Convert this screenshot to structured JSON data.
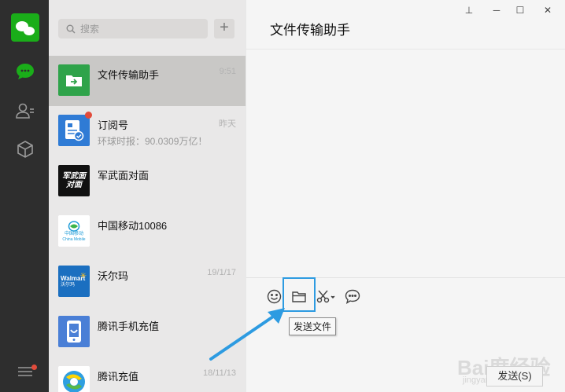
{
  "window": {
    "pin_icon": "pin-icon",
    "minimize_icon": "minimize-icon",
    "maximize_icon": "maximize-icon",
    "close_icon": "close-icon"
  },
  "sidebar": {
    "icons": [
      "chat-icon",
      "contacts-icon",
      "favorites-icon",
      "menu-icon"
    ]
  },
  "search": {
    "placeholder": "搜索",
    "add_label": "+"
  },
  "contacts": [
    {
      "name": "文件传输助手",
      "preview": "",
      "time": "9:51",
      "active": true,
      "unread": false
    },
    {
      "name": "订阅号",
      "preview": "环球时报：90.0309万亿！",
      "time": "昨天",
      "active": false,
      "unread": true
    },
    {
      "name": "军武面对面",
      "preview": "",
      "time": "",
      "active": false,
      "unread": false
    },
    {
      "name": "中国移动10086",
      "preview": "",
      "time": "",
      "active": false,
      "unread": false
    },
    {
      "name": "沃尔玛",
      "preview": "",
      "time": "19/1/17",
      "active": false,
      "unread": false
    },
    {
      "name": "腾讯手机充值",
      "preview": "",
      "time": "",
      "active": false,
      "unread": false
    },
    {
      "name": "腾讯充值",
      "preview": "",
      "time": "18/11/13",
      "active": false,
      "unread": false
    }
  ],
  "avatar_text": {
    "junwu": "军武面对面",
    "cmcc_cn": "中国移动",
    "cmcc_en": "China Mobile",
    "walmart": "Walmart",
    "walmart_cn": "沃尔玛"
  },
  "chat": {
    "title": "文件传输助手",
    "tooltip": "发送文件",
    "send_label": "发送(S)"
  },
  "watermark": {
    "text": "Bai度经验",
    "url": "jingyan.baidu.com"
  },
  "colors": {
    "accent": "#1aad19",
    "highlight": "#2d9be1",
    "rail": "#2e2e2e"
  }
}
